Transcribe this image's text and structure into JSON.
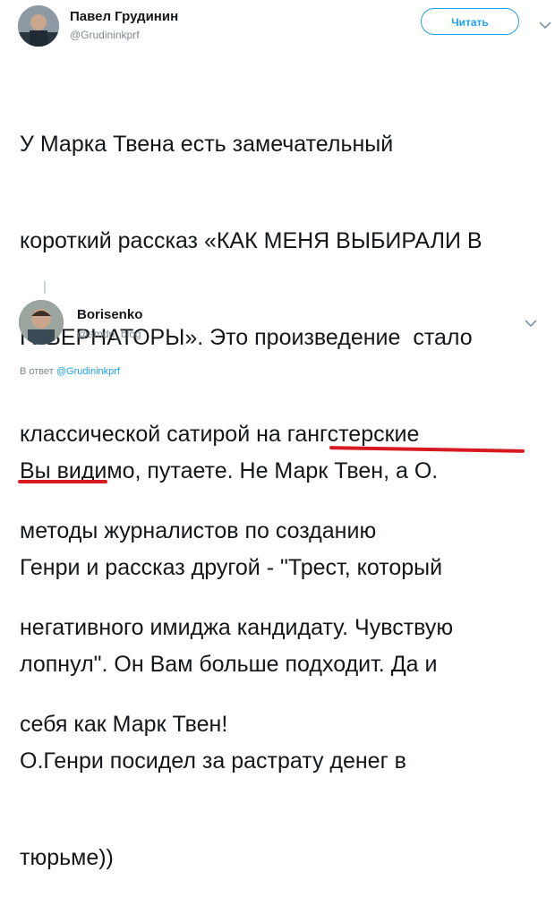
{
  "tweet": {
    "author_name": "Павел Грудинин",
    "author_handle": "@Grudininkprf",
    "follow_label": "Читать",
    "lines": [
      "У Марка Твена есть замечательный",
      "короткий рассказ «КАК МЕНЯ ВЫБИРАЛИ В",
      "ГУБЕРНАТОРЫ». Это произведение  стало",
      "классической сатирой на гангстерские",
      "методы журналистов по созданию",
      "негативного имиджа кандидату. Чувствую",
      "себя как Марк Твен!"
    ]
  },
  "reply": {
    "author_name": "Borisenko",
    "author_handle": "@amdn_blog",
    "in_reply_prefix": "В ответ",
    "in_reply_handle": "@Grudininkprf",
    "lines": [
      "Вы видимо, путаете. Не Марк Твен, а О.",
      "Генри и рассказ другой - \"Трест, который",
      "лопнул\". Он Вам больше подходит. Да и",
      "О.Генри посидел за растрату денег в",
      "тюрьме))"
    ]
  },
  "colors": {
    "accent": "#1da1f2",
    "underline": "#d71a21",
    "muted": "#7e8a93",
    "text": "#14171a"
  },
  "icons": {
    "expand": "chevron-down-icon"
  }
}
